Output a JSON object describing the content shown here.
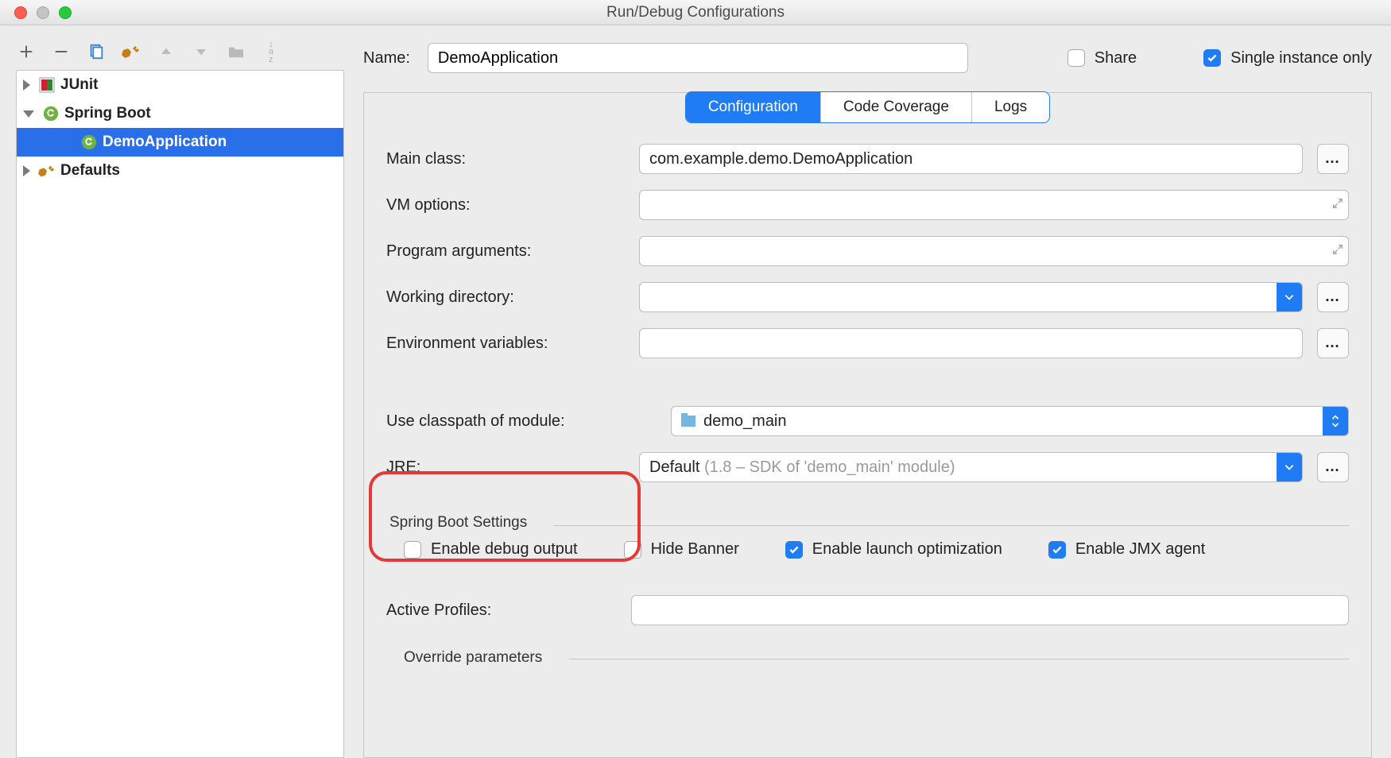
{
  "title": "Run/Debug Configurations",
  "toolbar": {
    "sort_hint": "a→z"
  },
  "tree": {
    "junit": "JUnit",
    "springboot": "Spring Boot",
    "demoapp": "DemoApplication",
    "defaults": "Defaults"
  },
  "name": {
    "label": "Name:",
    "value": "DemoApplication"
  },
  "share": {
    "label": "Share",
    "checked": false
  },
  "singleton": {
    "label": "Single instance only",
    "checked": true
  },
  "tabs": {
    "configuration": "Configuration",
    "code_coverage": "Code Coverage",
    "logs": "Logs"
  },
  "fields": {
    "main_class": {
      "label": "Main class:",
      "value": "com.example.demo.DemoApplication"
    },
    "vm_options": {
      "label": "VM options:",
      "value": ""
    },
    "program_args": {
      "label": "Program arguments:",
      "value": ""
    },
    "working_dir": {
      "label": "Working directory:",
      "value": ""
    },
    "env_vars": {
      "label": "Environment variables:",
      "value": ""
    },
    "classpath": {
      "label": "Use classpath of module:",
      "value": "demo_main"
    },
    "jre": {
      "label": "JRE:",
      "value_prefix": "Default ",
      "value_gray": "(1.8 – SDK of 'demo_main' module)"
    }
  },
  "spring_section": {
    "title": "Spring Boot Settings",
    "enable_debug": {
      "label": "Enable debug output",
      "checked": false
    },
    "hide_banner": {
      "label": "Hide Banner",
      "checked": false
    },
    "launch_opt": {
      "label": "Enable launch optimization",
      "checked": true
    },
    "jmx": {
      "label": "Enable JMX agent",
      "checked": true
    },
    "active_profiles_label": "Active Profiles:",
    "override_label": "Override parameters"
  }
}
